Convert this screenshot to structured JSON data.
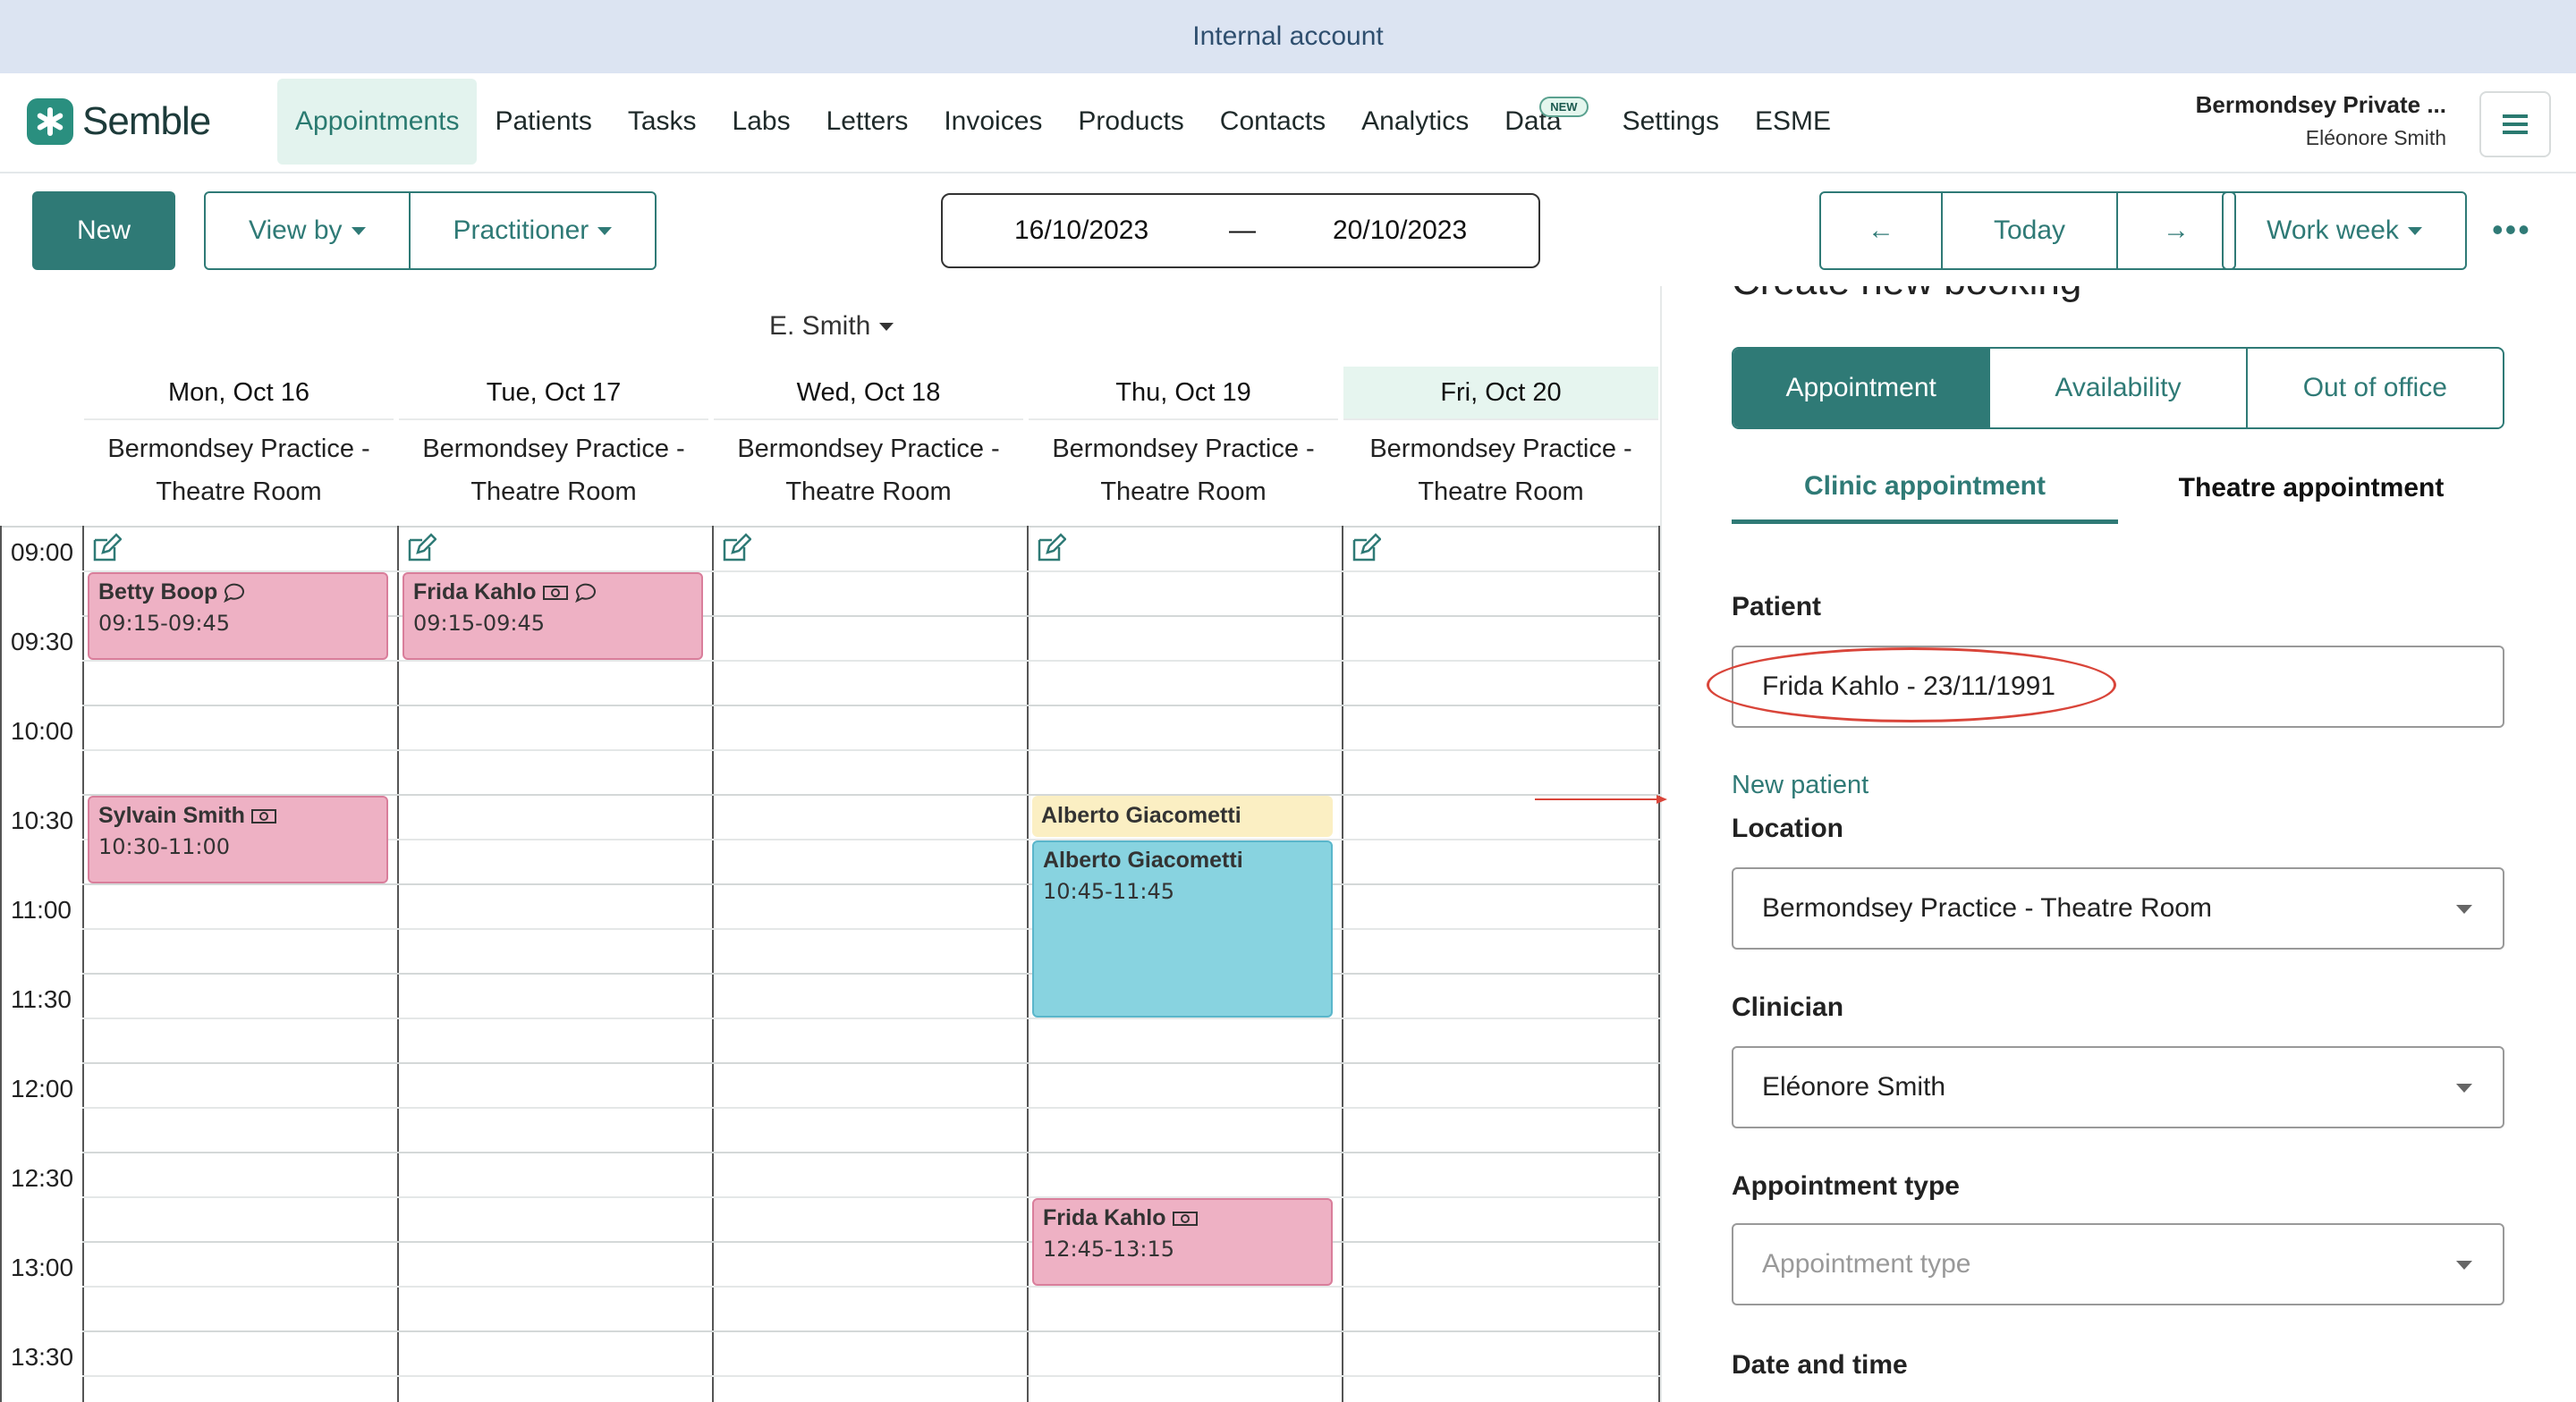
{
  "banner": {
    "text": "Internal account"
  },
  "brand": {
    "name": "Semble",
    "accent": "#2f7a76"
  },
  "nav": {
    "items": [
      "Appointments",
      "Patients",
      "Tasks",
      "Labs",
      "Letters",
      "Invoices",
      "Products",
      "Contacts",
      "Analytics",
      "Data",
      "Settings",
      "ESME"
    ],
    "active": "Appointments",
    "badge": "NEW",
    "org_name": "Bermondsey Private ...",
    "user_name": "Eléonore Smith"
  },
  "toolbar": {
    "new_label": "New",
    "view_by_label": "View by",
    "practitioner_label": "Practitioner",
    "date_from": "16/10/2023",
    "date_sep": "—",
    "date_to": "20/10/2023",
    "prev_label": "←",
    "today_label": "Today",
    "next_label": "→",
    "view_mode": "Work week",
    "more_label": "•••"
  },
  "calendar": {
    "practitioner": "E. Smith",
    "days": [
      {
        "label": "Mon, Oct 16",
        "loc1": "Bermondsey Practice -",
        "loc2": "Theatre Room"
      },
      {
        "label": "Tue, Oct 17",
        "loc1": "Bermondsey Practice -",
        "loc2": "Theatre Room"
      },
      {
        "label": "Wed, Oct 18",
        "loc1": "Bermondsey Practice -",
        "loc2": "Theatre Room"
      },
      {
        "label": "Thu, Oct 19",
        "loc1": "Bermondsey Practice -",
        "loc2": "Theatre Room"
      },
      {
        "label": "Fri, Oct 20",
        "loc1": "Bermondsey Practice -",
        "loc2": "Theatre Room"
      }
    ],
    "times": [
      "09:00",
      "09:30",
      "10:00",
      "10:30",
      "11:00",
      "11:30",
      "12:00",
      "12:30",
      "13:00",
      "13:30"
    ],
    "appointments": [
      {
        "name": "Betty Boop",
        "time": "09:15-09:45",
        "color": "pink"
      },
      {
        "name": "Frida Kahlo",
        "time": "09:15-09:45",
        "color": "pink"
      },
      {
        "name": "Sylvain Smith",
        "time": "10:30-11:00",
        "color": "pink"
      },
      {
        "name": "Alberto Giacometti",
        "time": "",
        "color": "yellow"
      },
      {
        "name": "Alberto Giacometti",
        "time": "10:45-11:45",
        "color": "blue"
      },
      {
        "name": "Frida Kahlo",
        "time": "12:45-13:15",
        "color": "pink"
      }
    ]
  },
  "panel": {
    "title": "Create new booking",
    "tabs": [
      "Appointment",
      "Availability",
      "Out of office"
    ],
    "subtabs": [
      "Clinic appointment",
      "Theatre appointment"
    ],
    "patient_label": "Patient",
    "patient_value": "Frida Kahlo - 23/11/1991",
    "new_patient_link": "New patient",
    "location_label": "Location",
    "location_value": "Bermondsey Practice - Theatre Room",
    "clinician_label": "Clinician",
    "clinician_value": "Eléonore Smith",
    "appt_type_label": "Appointment type",
    "appt_type_placeholder": "Appointment type",
    "datetime_label": "Date and time"
  }
}
